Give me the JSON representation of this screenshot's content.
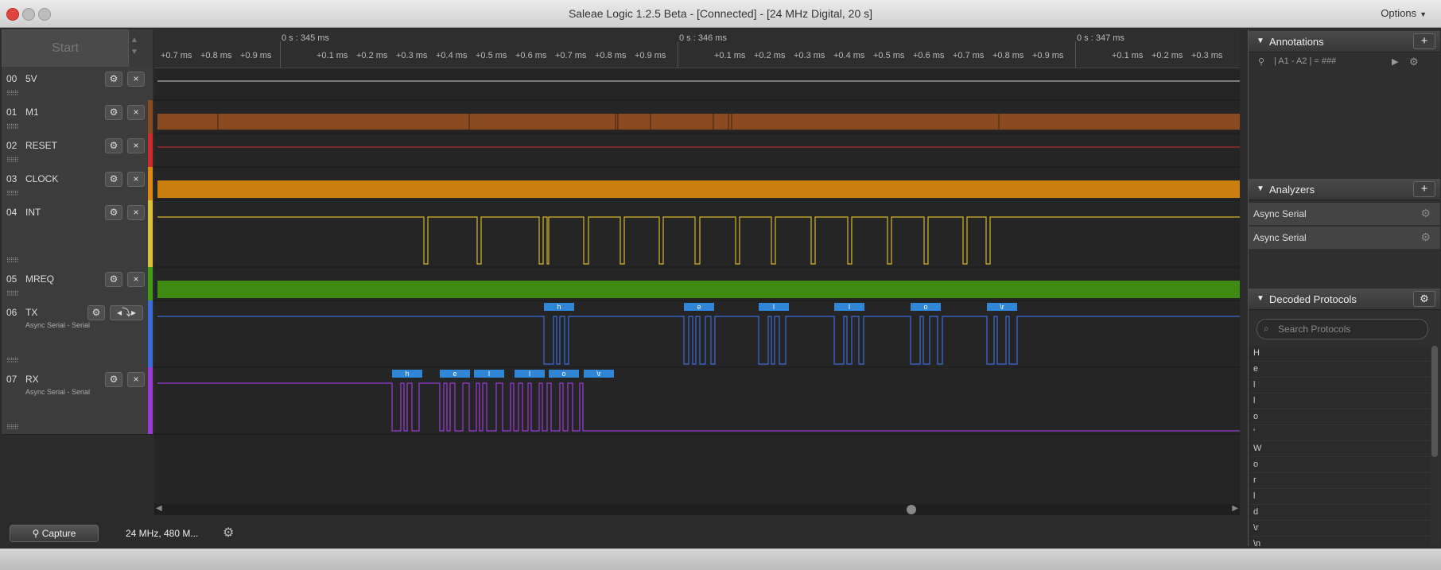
{
  "window": {
    "title": "Saleae Logic 1.2.5 Beta - [Connected] - [24 MHz Digital, 20 s]",
    "options_label": "Options"
  },
  "start_label": "Start",
  "ruler": {
    "major": [
      "0 s : 345 ms",
      "0 s : 346 ms",
      "0 s : 347 ms"
    ],
    "minor_a": [
      "+0.7 ms",
      "+0.8 ms",
      "+0.9 ms"
    ],
    "minor_b": [
      "+0.1 ms",
      "+0.2 ms",
      "+0.3 ms",
      "+0.4 ms",
      "+0.5 ms",
      "+0.6 ms",
      "+0.7 ms",
      "+0.8 ms",
      "+0.9 ms"
    ],
    "minor_c": [
      "+0.1 ms",
      "+0.2 ms",
      "+0.3 ms",
      "+0.4 ms",
      "+0.5 ms",
      "+0.6 ms",
      "+0.7 ms",
      "+0.8 ms",
      "+0.9 ms"
    ],
    "minor_d": [
      "+0.1 ms",
      "+0.2 ms",
      "+0.3 ms"
    ]
  },
  "channels": [
    {
      "num": "00",
      "name": "5V",
      "sub": "",
      "color": "#555555"
    },
    {
      "num": "01",
      "name": "M1",
      "sub": "",
      "color": "#8a4a1f"
    },
    {
      "num": "02",
      "name": "RESET",
      "sub": "",
      "color": "#cc2b2b"
    },
    {
      "num": "03",
      "name": "CLOCK",
      "sub": "",
      "color": "#d88a12"
    },
    {
      "num": "04",
      "name": "INT",
      "sub": "",
      "color": "#d8c23a"
    },
    {
      "num": "05",
      "name": "MREQ",
      "sub": "",
      "color": "#3e9a16"
    },
    {
      "num": "06",
      "name": "TX",
      "sub": "Async Serial - Serial",
      "color": "#3a6bd8"
    },
    {
      "num": "07",
      "name": "RX",
      "sub": "Async Serial - Serial",
      "color": "#9a3bd8"
    }
  ],
  "tx_labels": [
    "h",
    "e",
    "l",
    "l",
    "o",
    "\\r"
  ],
  "rx_labels": [
    "h",
    "e",
    "l",
    "l",
    "o",
    "\\r"
  ],
  "statusbar": {
    "capture_label": "Capture",
    "rate_text": "24 MHz, 480 M..."
  },
  "annotations": {
    "title": "Annotations",
    "row": "| A1 - A2 | = ###"
  },
  "analyzers": {
    "title": "Analyzers",
    "items": [
      "Async Serial",
      "Async Serial"
    ]
  },
  "decoded": {
    "title": "Decoded Protocols",
    "search_placeholder": "Search Protocols",
    "items": [
      "H",
      "e",
      "l",
      "l",
      "o",
      "'",
      "W",
      "o",
      "r",
      "l",
      "d",
      "\\r",
      "\\n"
    ]
  }
}
